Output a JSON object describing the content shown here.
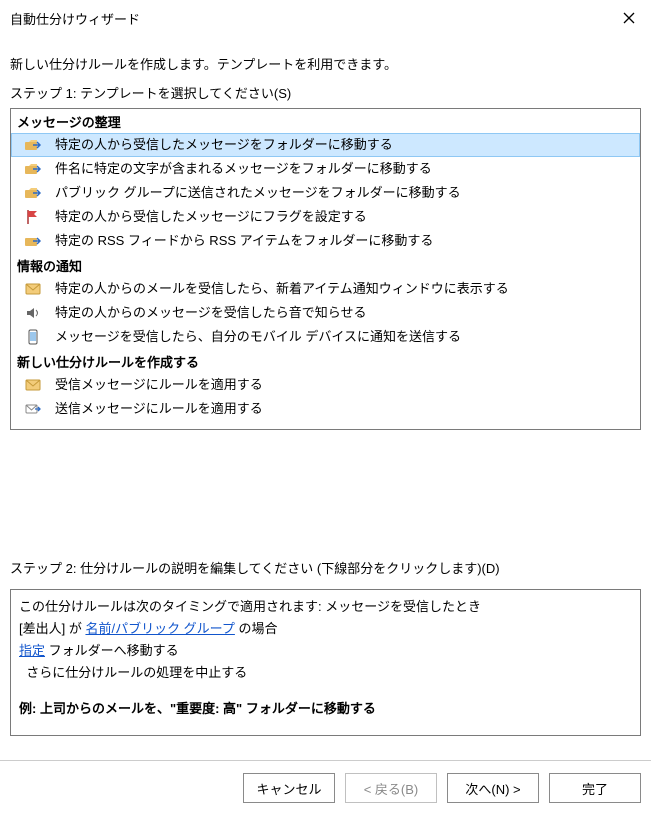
{
  "window": {
    "title": "自動仕分けウィザード"
  },
  "lead": "新しい仕分けルールを作成します。テンプレートを利用できます。",
  "step1_label": "ステップ 1: テンプレートを選択してください(S)",
  "step2_label": "ステップ 2: 仕分けルールの説明を編集してください (下線部分をクリックします)(D)",
  "groups": {
    "g1": {
      "header": "メッセージの整理",
      "items": [
        "特定の人から受信したメッセージをフォルダーに移動する",
        "件名に特定の文字が含まれるメッセージをフォルダーに移動する",
        "パブリック グループに送信されたメッセージをフォルダーに移動する",
        "特定の人から受信したメッセージにフラグを設定する",
        "特定の RSS フィードから RSS アイテムをフォルダーに移動する"
      ]
    },
    "g2": {
      "header": "情報の通知",
      "items": [
        "特定の人からのメールを受信したら、新着アイテム通知ウィンドウに表示する",
        "特定の人からのメッセージを受信したら音で知らせる",
        "メッセージを受信したら、自分のモバイル デバイスに通知を送信する"
      ]
    },
    "g3": {
      "header": "新しい仕分けルールを作成する",
      "items": [
        "受信メッセージにルールを適用する",
        "送信メッセージにルールを適用する"
      ]
    }
  },
  "selected_index": "g1.0",
  "desc": {
    "line1": "この仕分けルールは次のタイミングで適用されます: メッセージを受信したとき",
    "line2_pre": "[差出人] が ",
    "line2_link": "名前/パブリック グループ",
    "line2_post": " の場合",
    "line3_link": "指定",
    "line3_post": " フォルダーへ移動する",
    "line4": "  さらに仕分けルールの処理を中止する",
    "example": "例: 上司からのメールを、\"重要度: 高\" フォルダーに移動する"
  },
  "buttons": {
    "cancel": "キャンセル",
    "back": "< 戻る(B)",
    "next": "次へ(N) >",
    "finish": "完了"
  }
}
